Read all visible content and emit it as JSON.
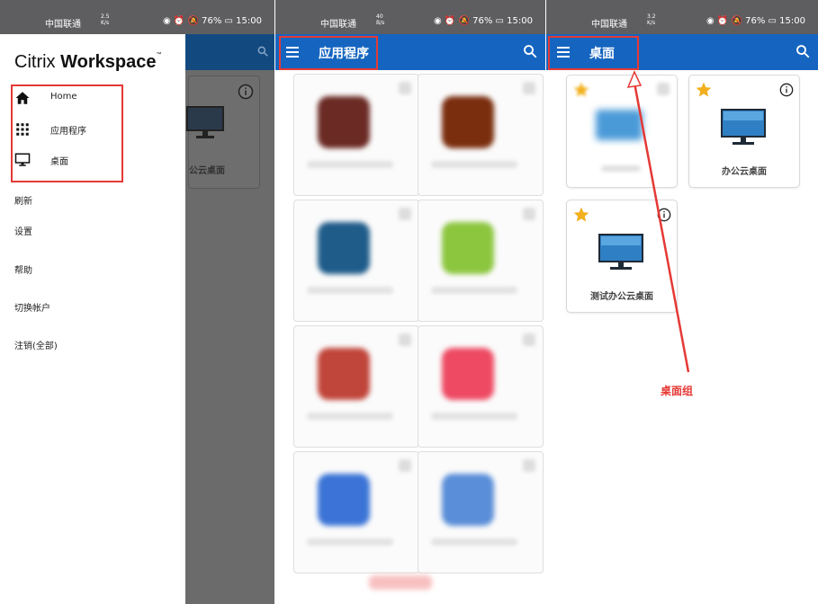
{
  "status": {
    "carrier": "中国联通",
    "right": "◉ ⏰ 🔕 76% ▭ 15:00",
    "panels": [
      {
        "speed_value": "2.5",
        "speed_unit": "K/s"
      },
      {
        "speed_value": "40",
        "speed_unit": "B/s"
      },
      {
        "speed_value": "3.2",
        "speed_unit": "K/s"
      }
    ]
  },
  "drawer": {
    "brand_light": "Citrix ",
    "brand_bold": "Workspace",
    "brand_tm": "™",
    "nav": [
      {
        "label": "Home",
        "icon": "home-icon"
      },
      {
        "label": "应用程序",
        "icon": "apps-grid-icon"
      },
      {
        "label": "桌面",
        "icon": "monitor-icon"
      }
    ],
    "menu": [
      "刷新",
      "设置",
      "帮助",
      "切换帐户",
      "注销(全部)"
    ],
    "dim_card_label": "公云桌面"
  },
  "apps_screen": {
    "title": "应用程序"
  },
  "desktops_screen": {
    "title": "桌面",
    "cards": [
      {
        "label": "办公云桌面"
      },
      {
        "label": "测试办公云桌面"
      }
    ],
    "annotation": "桌面组"
  },
  "colors": {
    "brand_blue": "#1565c0",
    "highlight_red": "#e53935",
    "star_gold": "#f2b01e"
  }
}
